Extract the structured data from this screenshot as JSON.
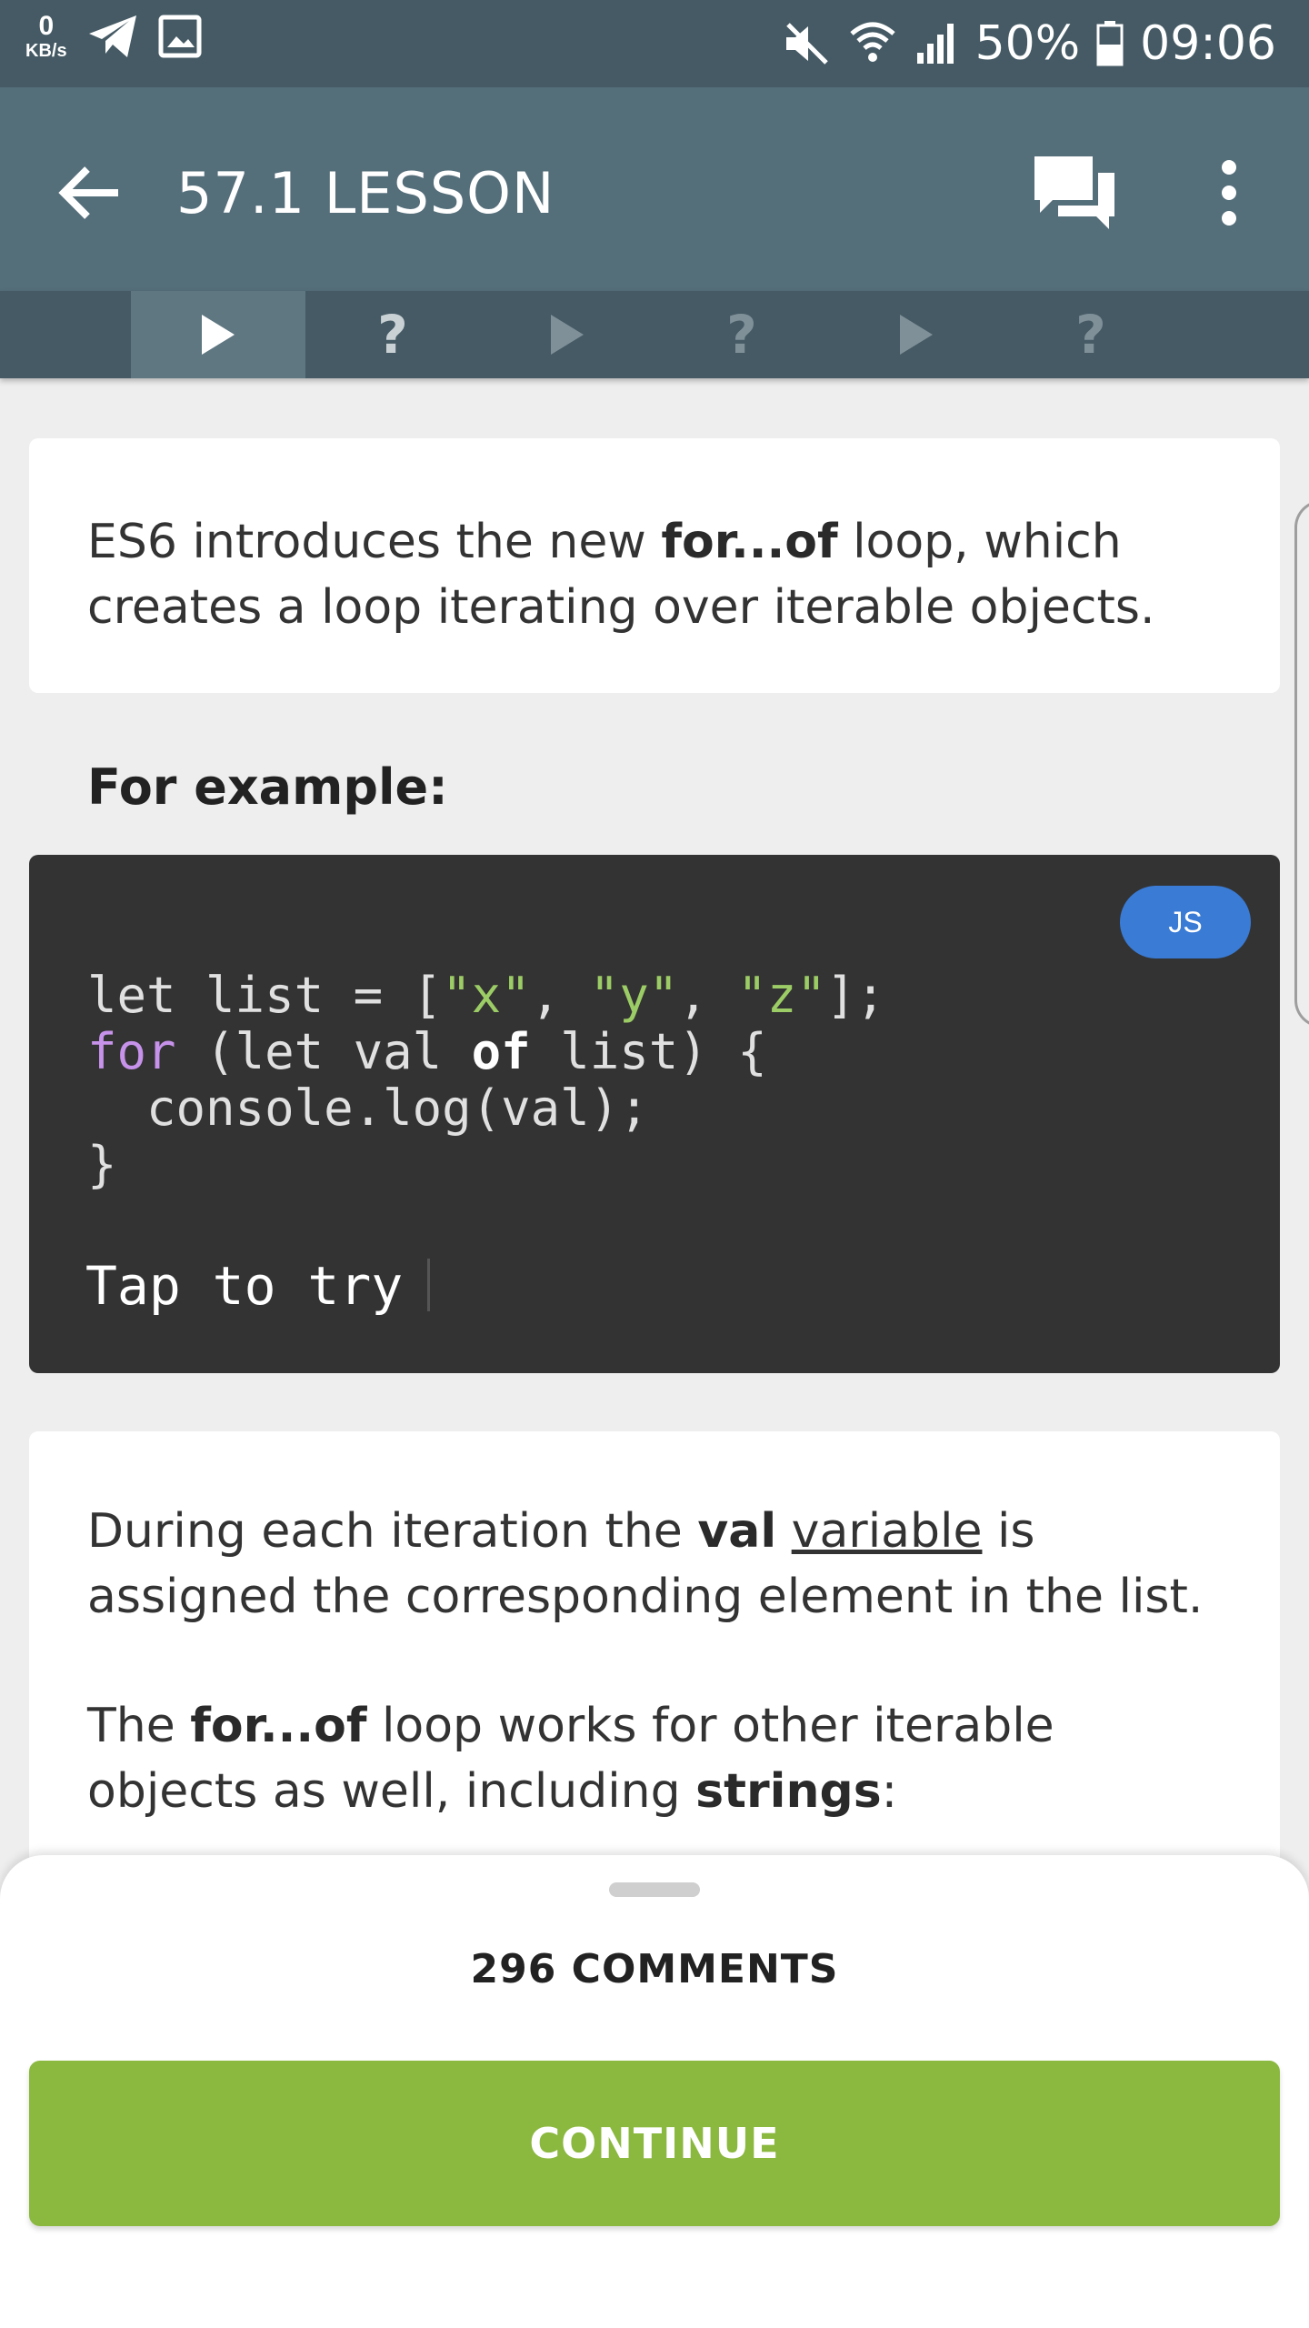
{
  "status_bar": {
    "net_speed": "0",
    "net_unit": "KB/s",
    "battery": "50%",
    "time": "09:06"
  },
  "app_bar": {
    "title": "57.1 LESSON"
  },
  "steps": [
    {
      "type": "play",
      "active": true
    },
    {
      "type": "quiz",
      "label": "?"
    },
    {
      "type": "play",
      "active": false
    },
    {
      "type": "quiz",
      "label": "?"
    },
    {
      "type": "play",
      "active": false
    },
    {
      "type": "quiz",
      "label": "?"
    }
  ],
  "intro": {
    "p1": "ES6 introduces the new ",
    "b1": "for...of",
    "p2": " loop, which creates a loop iterating over iterable objects."
  },
  "example_label": "For example:",
  "code": {
    "language_badge": "JS",
    "l1a": "let list = [",
    "s1": "\"x\"",
    "c1": ", ",
    "s2": "\"y\"",
    "c2": ", ",
    "s3": "\"z\"",
    "l1b": "];",
    "k1": "for",
    "l2a": " (let val ",
    "k2": "of",
    "l2b": " list) {",
    "l3": "  console.log(val);",
    "l4": "}",
    "tap_hint": "Tap to try"
  },
  "explain": {
    "a": "During each iteration the ",
    "b": "val",
    "c": " ",
    "link": "variable",
    "d": " is assigned the corresponding element in the list.",
    "e": "The ",
    "f": "for...of",
    "g": " loop works for other iterable objects as well, including ",
    "h": "strings",
    "i": ":"
  },
  "sheet": {
    "comments": "296 COMMENTS",
    "continue": "CONTINUE"
  },
  "colors": {
    "status_bar": "#455a64",
    "app_bar": "#546e7a",
    "continue": "#8bb83f",
    "badge": "#3a7bd5",
    "code_bg": "#333333"
  }
}
